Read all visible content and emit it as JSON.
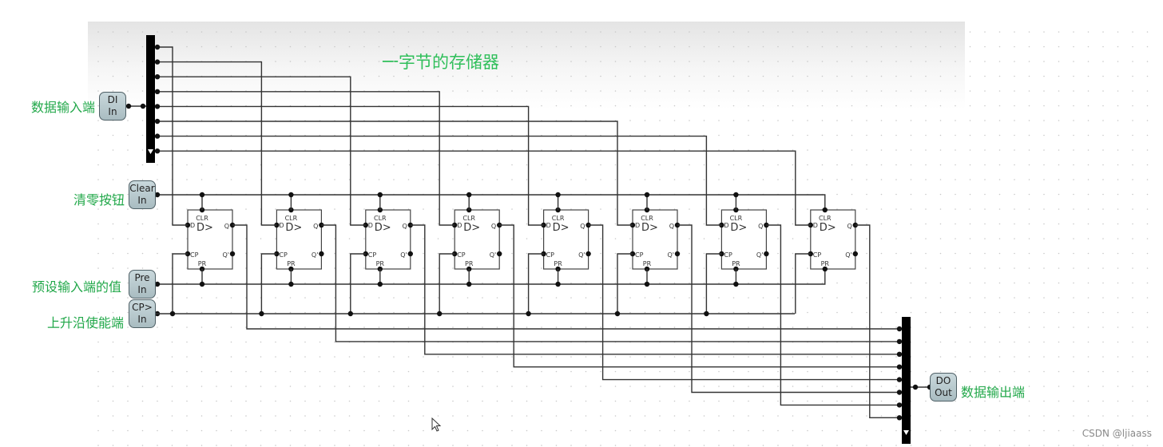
{
  "title": "一字节的存储器",
  "labels": {
    "data_in": "数据输入端",
    "clear": "清零按钮",
    "preset": "预设输入端的值",
    "clock": "上升沿使能端",
    "data_out": "数据输出端"
  },
  "pins": {
    "data_in": {
      "line1": "DI",
      "line2": "In"
    },
    "clear": {
      "line1": "Clear",
      "line2": "In"
    },
    "preset": {
      "line1": "Pre",
      "line2": "In"
    },
    "clock": {
      "line1": "CP>",
      "line2": "In"
    },
    "data_out": {
      "line1": "DO",
      "line2": "Out"
    }
  },
  "flipflop": {
    "count": 8,
    "type_label": "D>",
    "pin_labels": {
      "d": "D",
      "clr": "CLR",
      "cp": "CP",
      "pr": "PR",
      "q": "Q",
      "qn": "Q'"
    }
  },
  "splitter_bits": 8,
  "watermark": "CSDN @ljiaass",
  "colors": {
    "label": "#22a84a",
    "wire": "#333333",
    "pin_fill": "#b8c9ce"
  }
}
